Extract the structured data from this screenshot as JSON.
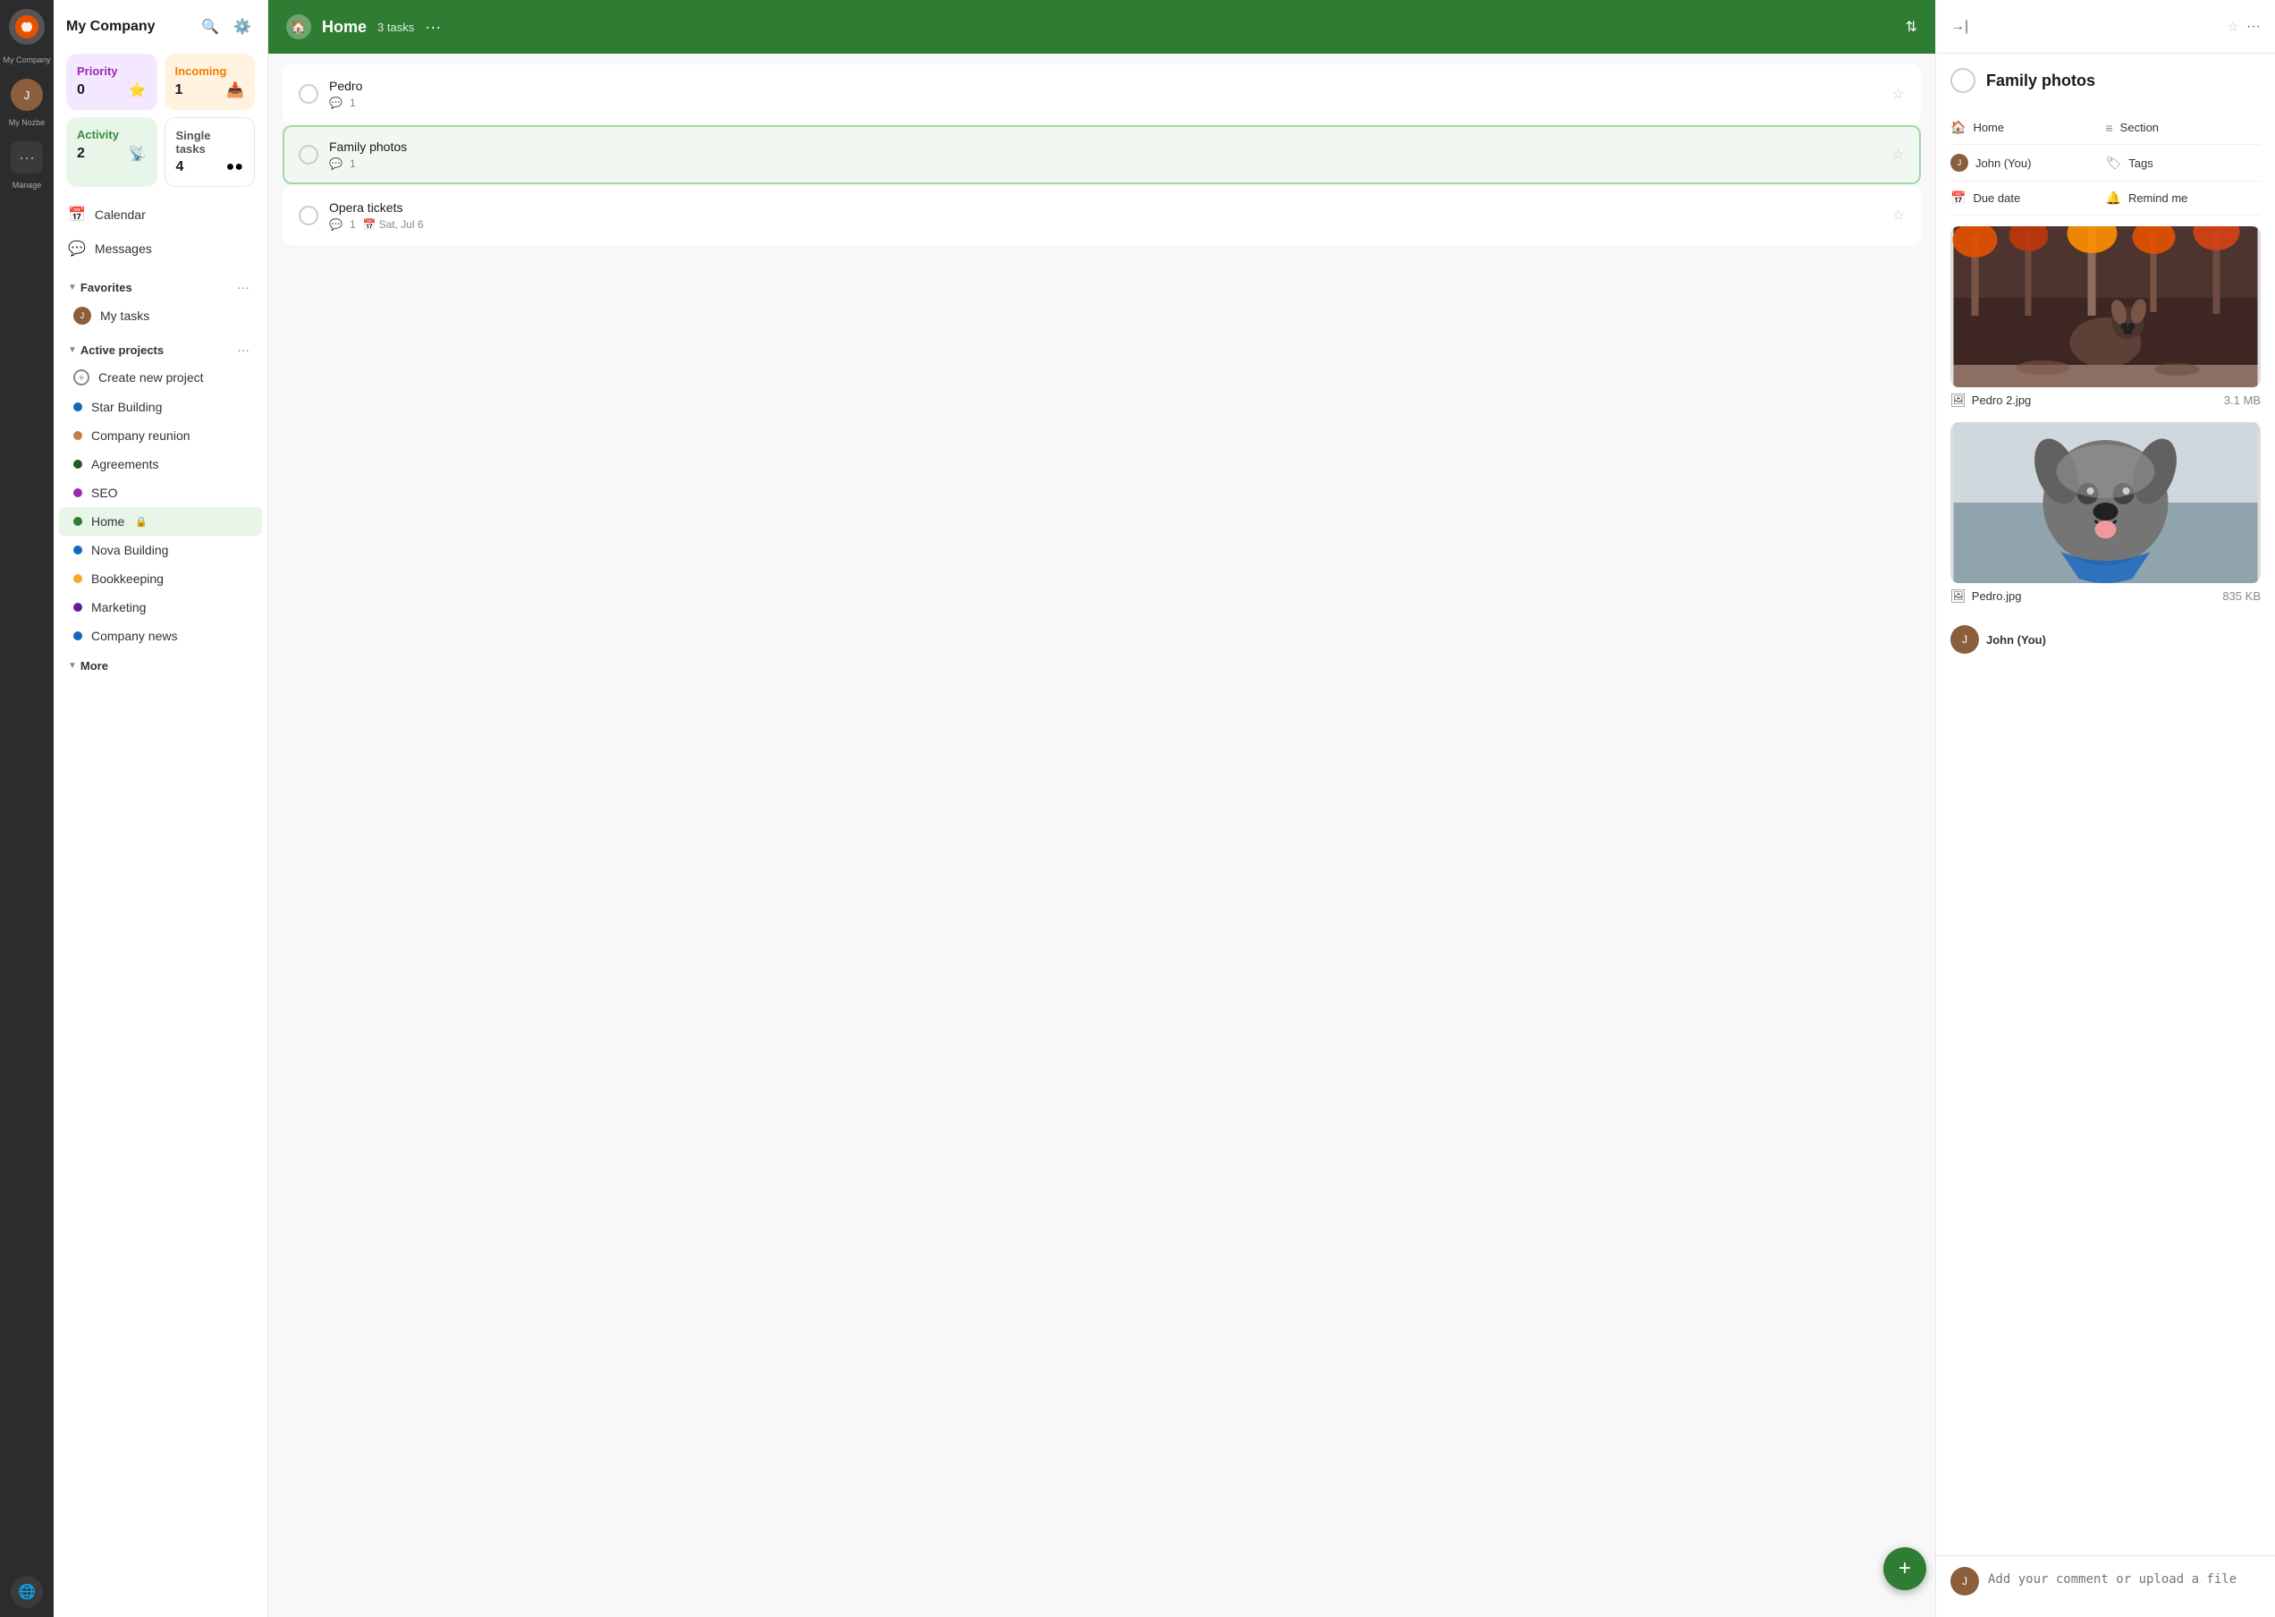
{
  "app": {
    "name": "My Company",
    "company_label": "My Company",
    "my_nozbe_label": "My Nozbe",
    "manage_label": "Manage"
  },
  "dashboard": {
    "priority": {
      "label": "Priority",
      "count": 0,
      "icon": "⭐"
    },
    "incoming": {
      "label": "Incoming",
      "count": 1,
      "icon": "📥"
    },
    "activity": {
      "label": "Activity",
      "count": 2,
      "icon": "📡"
    },
    "single": {
      "label": "Single tasks",
      "count": 4,
      "icon": "●●●"
    }
  },
  "nav": {
    "calendar": "Calendar",
    "messages": "Messages"
  },
  "favorites": {
    "section_label": "Favorites",
    "my_tasks": "My tasks"
  },
  "active_projects": {
    "section_label": "Active projects",
    "items": [
      {
        "label": "Create new project",
        "color": "plus",
        "dot_color": ""
      },
      {
        "label": "Star Building",
        "color": "#1565C0",
        "dot_color": "#1565C0"
      },
      {
        "label": "Company reunion",
        "color": "#C08050",
        "dot_color": "#C08050"
      },
      {
        "label": "Agreements",
        "color": "#2e7d32",
        "dot_color": "#1B5E20"
      },
      {
        "label": "SEO",
        "color": "#9C27B0",
        "dot_color": "#9C27B0"
      },
      {
        "label": "Home",
        "color": "#2e7d32",
        "dot_color": "#2e7d32",
        "active": true,
        "lock": true
      },
      {
        "label": "Nova Building",
        "color": "#1565C0",
        "dot_color": "#1565C0"
      },
      {
        "label": "Bookkeeping",
        "color": "#F9A825",
        "dot_color": "#F9A825"
      },
      {
        "label": "Marketing",
        "color": "#6A1B9A",
        "dot_color": "#6A1B9A"
      },
      {
        "label": "Company news",
        "color": "#1565C0",
        "dot_color": "#1565C0"
      }
    ]
  },
  "more": {
    "section_label": "More"
  },
  "main_header": {
    "icon": "🏠",
    "title": "Home",
    "task_count": "3 tasks",
    "more_icon": "···",
    "sort_label": "⇅"
  },
  "tasks": [
    {
      "id": 1,
      "title": "Pedro",
      "comments": 1,
      "date": null,
      "selected": false,
      "starred": false
    },
    {
      "id": 2,
      "title": "Family photos",
      "comments": 1,
      "date": null,
      "selected": true,
      "starred": false
    },
    {
      "id": 3,
      "title": "Opera tickets",
      "comments": 1,
      "date": "Sat, Jul 6",
      "selected": false,
      "starred": false
    }
  ],
  "right_panel": {
    "task_title": "Family photos",
    "fields": {
      "project_label": "Home",
      "project_icon": "🏠",
      "section_label": "Section",
      "section_icon": "≡",
      "assignee_label": "John (You)",
      "tags_label": "Tags",
      "due_date_label": "Due date",
      "remind_label": "Remind me"
    },
    "attachments": [
      {
        "name": "Pedro 2.jpg",
        "size": "3.1 MB"
      },
      {
        "name": "Pedro.jpg",
        "size": "835 KB"
      }
    ],
    "commenter_name": "John (You)",
    "comment_placeholder": "Add your comment or upload a file"
  },
  "fab": {
    "label": "+"
  }
}
